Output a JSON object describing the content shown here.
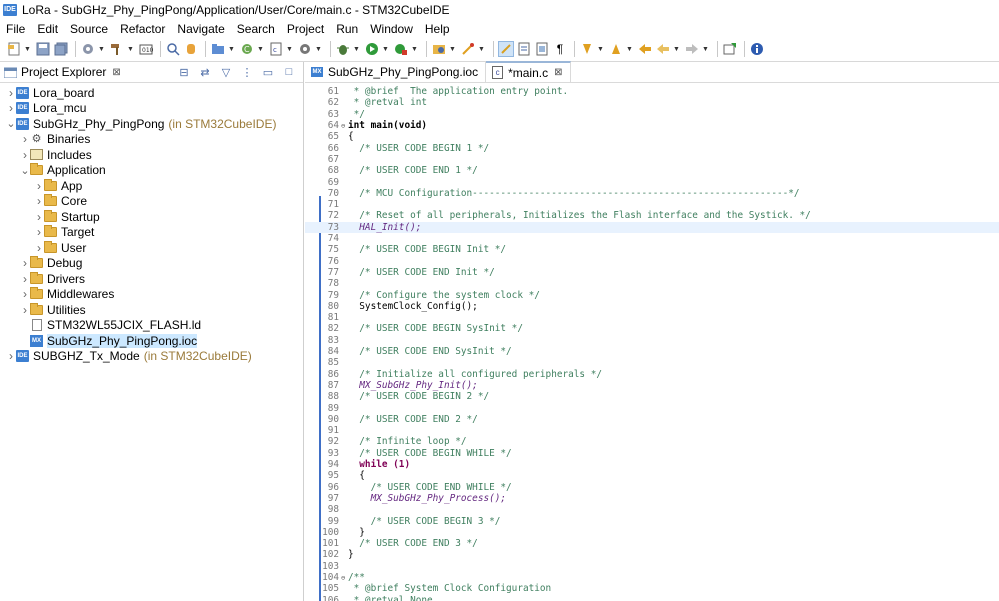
{
  "window": {
    "app_icon_text": "IDE",
    "title": "LoRa - SubGHz_Phy_PingPong/Application/User/Core/main.c - STM32CubeIDE"
  },
  "menu": [
    "File",
    "Edit",
    "Source",
    "Refactor",
    "Navigate",
    "Search",
    "Project",
    "Run",
    "Window",
    "Help"
  ],
  "toolbar_icons": [
    "new-icon",
    "save-icon",
    "save-all-icon",
    "build-config-icon",
    "build-icon",
    "build-target-icon",
    "search-icon",
    "debug-icon",
    "new-folder-icon",
    "new-class-icon",
    "new-source-icon",
    "run-external-icon",
    "debug-bug-icon",
    "run-icon",
    "stop-icon",
    "open-perspective-icon",
    "toggle-mark-icon",
    "word-wrap-icon",
    "show-whitespace-icon",
    "pilcrow-icon",
    "next-annotation-icon",
    "prev-annotation-icon",
    "last-edit-icon",
    "back-icon",
    "forward-icon",
    "pin-editor-icon",
    "info-icon"
  ],
  "explorer": {
    "tab_label": "Project Explorer",
    "tab_close": "⊠",
    "tree": [
      {
        "label": "Lora_board",
        "icon": "ide",
        "depth": 0,
        "expanded": false
      },
      {
        "label": "Lora_mcu",
        "icon": "ide",
        "depth": 0,
        "expanded": false
      },
      {
        "label": "SubGHz_Phy_PingPong",
        "tag": "(in STM32CubeIDE)",
        "icon": "ide",
        "depth": 0,
        "expanded": true
      },
      {
        "label": "Binaries",
        "icon": "binary",
        "depth": 1,
        "expanded": false
      },
      {
        "label": "Includes",
        "icon": "include",
        "depth": 1,
        "expanded": false
      },
      {
        "label": "Application",
        "icon": "folder",
        "depth": 1,
        "expanded": true
      },
      {
        "label": "App",
        "icon": "folder",
        "depth": 2,
        "expanded": false
      },
      {
        "label": "Core",
        "icon": "folder",
        "depth": 2,
        "expanded": false
      },
      {
        "label": "Startup",
        "icon": "folder",
        "depth": 2,
        "expanded": false
      },
      {
        "label": "Target",
        "icon": "folder",
        "depth": 2,
        "expanded": false
      },
      {
        "label": "User",
        "icon": "folder",
        "depth": 2,
        "expanded": false
      },
      {
        "label": "Debug",
        "icon": "folder",
        "depth": 1,
        "expanded": false
      },
      {
        "label": "Drivers",
        "icon": "folder",
        "depth": 1,
        "expanded": false
      },
      {
        "label": "Middlewares",
        "icon": "folder",
        "depth": 1,
        "expanded": false
      },
      {
        "label": "Utilities",
        "icon": "folder",
        "depth": 1,
        "expanded": false
      },
      {
        "label": "STM32WL55JCIX_FLASH.ld",
        "icon": "file",
        "depth": 1,
        "leaf": true
      },
      {
        "label": "SubGHz_Phy_PingPong.ioc",
        "icon": "mx",
        "depth": 1,
        "leaf": true,
        "selected": true
      },
      {
        "label": "SUBGHZ_Tx_Mode",
        "tag": "(in STM32CubeIDE)",
        "icon": "ide",
        "depth": 0,
        "expanded": false
      }
    ]
  },
  "editor": {
    "tabs": [
      {
        "label": "SubGHz_Phy_PingPong.ioc",
        "icon": "mx",
        "active": false
      },
      {
        "label": "*main.c",
        "icon": "c",
        "active": true,
        "close": "⊠"
      }
    ],
    "lines": [
      {
        "n": "61",
        "t": " * @brief  The application entry point.",
        "c": "cmt"
      },
      {
        "n": "62",
        "t": " * @retval int",
        "c": "cmt"
      },
      {
        "n": "63",
        "t": " */",
        "c": "cmt"
      },
      {
        "n": "64",
        "t": "int main(void)",
        "c": "fn",
        "fold": "⊖"
      },
      {
        "n": "65",
        "t": "{",
        "c": ""
      },
      {
        "n": "66",
        "t": "  /* USER CODE BEGIN 1 */",
        "c": "cmt"
      },
      {
        "n": "67",
        "t": "",
        "c": ""
      },
      {
        "n": "68",
        "t": "  /* USER CODE END 1 */",
        "c": "cmt"
      },
      {
        "n": "69",
        "t": "",
        "c": ""
      },
      {
        "n": "70",
        "t": "  /* MCU Configuration--------------------------------------------------------*/",
        "c": "cmt"
      },
      {
        "n": "71",
        "t": "",
        "c": ""
      },
      {
        "n": "72",
        "t": "  /* Reset of all peripherals, Initializes the Flash interface and the Systick. */",
        "c": "cmt"
      },
      {
        "n": "73",
        "t": "  HAL_Init();",
        "c": "macro",
        "current": true
      },
      {
        "n": "74",
        "t": "",
        "c": ""
      },
      {
        "n": "75",
        "t": "  /* USER CODE BEGIN Init */",
        "c": "cmt"
      },
      {
        "n": "76",
        "t": "",
        "c": ""
      },
      {
        "n": "77",
        "t": "  /* USER CODE END Init */",
        "c": "cmt"
      },
      {
        "n": "78",
        "t": "",
        "c": ""
      },
      {
        "n": "79",
        "t": "  /* Configure the system clock */",
        "c": "cmt"
      },
      {
        "n": "80",
        "t": "  SystemClock_Config();",
        "c": ""
      },
      {
        "n": "81",
        "t": "",
        "c": ""
      },
      {
        "n": "82",
        "t": "  /* USER CODE BEGIN SysInit */",
        "c": "cmt"
      },
      {
        "n": "83",
        "t": "",
        "c": ""
      },
      {
        "n": "84",
        "t": "  /* USER CODE END SysInit */",
        "c": "cmt"
      },
      {
        "n": "85",
        "t": "",
        "c": ""
      },
      {
        "n": "86",
        "t": "  /* Initialize all configured peripherals */",
        "c": "cmt"
      },
      {
        "n": "87",
        "t": "  MX_SubGHz_Phy_Init();",
        "c": "macro"
      },
      {
        "n": "88",
        "t": "  /* USER CODE BEGIN 2 */",
        "c": "cmt"
      },
      {
        "n": "89",
        "t": "",
        "c": ""
      },
      {
        "n": "90",
        "t": "  /* USER CODE END 2 */",
        "c": "cmt"
      },
      {
        "n": "91",
        "t": "",
        "c": ""
      },
      {
        "n": "92",
        "t": "  /* Infinite loop */",
        "c": "cmt"
      },
      {
        "n": "93",
        "t": "  /* USER CODE BEGIN WHILE */",
        "c": "cmt"
      },
      {
        "n": "94",
        "t": "  while (1)",
        "c": "kw"
      },
      {
        "n": "95",
        "t": "  {",
        "c": ""
      },
      {
        "n": "96",
        "t": "    /* USER CODE END WHILE */",
        "c": "cmt"
      },
      {
        "n": "97",
        "t": "    MX_SubGHz_Phy_Process();",
        "c": "macro"
      },
      {
        "n": "98",
        "t": "",
        "c": ""
      },
      {
        "n": "99",
        "t": "    /* USER CODE BEGIN 3 */",
        "c": "cmt"
      },
      {
        "n": "100",
        "t": "  }",
        "c": ""
      },
      {
        "n": "101",
        "t": "  /* USER CODE END 3 */",
        "c": "cmt"
      },
      {
        "n": "102",
        "t": "}",
        "c": ""
      },
      {
        "n": "103",
        "t": "",
        "c": ""
      },
      {
        "n": "104",
        "t": "/**",
        "c": "cmt",
        "fold": "⊖"
      },
      {
        "n": "105",
        "t": " * @brief System Clock Configuration",
        "c": "cmt"
      },
      {
        "n": "106",
        "t": " * @retval None",
        "c": "cmt"
      }
    ]
  }
}
